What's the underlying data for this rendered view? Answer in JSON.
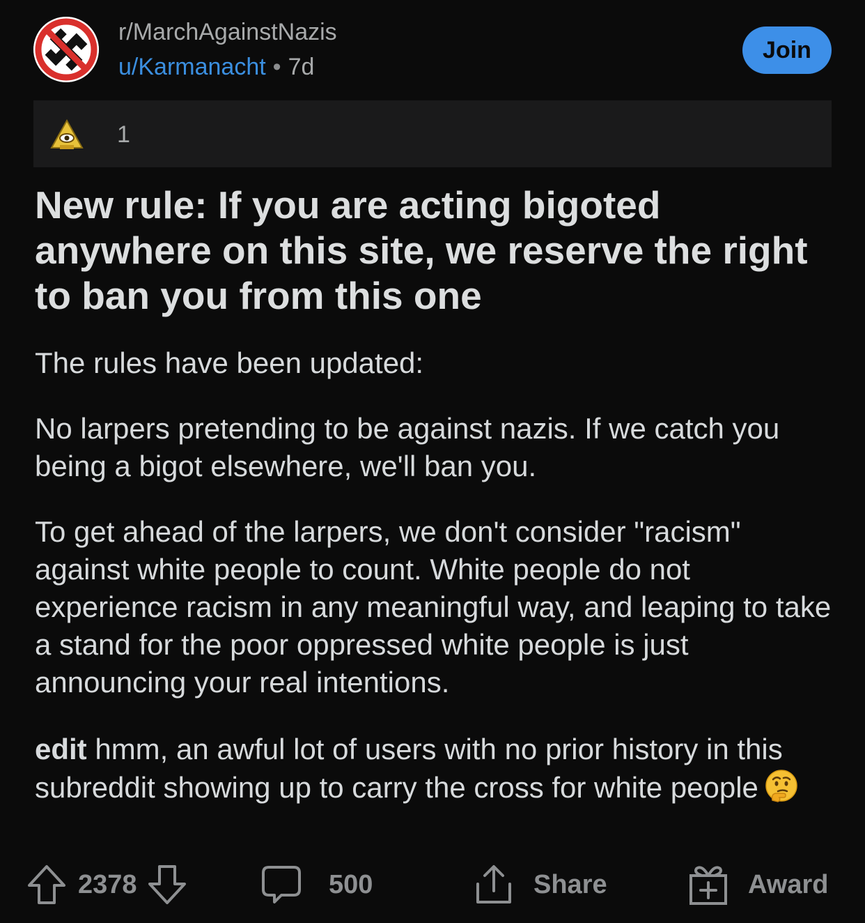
{
  "post": {
    "subreddit": "r/MarchAgainstNazis",
    "author": "u/Karmanacht",
    "separator": "•",
    "age": "7d",
    "join_label": "Join",
    "award_count": "1",
    "title": "New rule: If you are acting bigoted anywhere on this site, we reserve the right to ban you from this one",
    "body": {
      "p1": "The rules have been updated:",
      "p2": "No larpers pretending to be against nazis. If we catch you being a bigot elsewhere, we'll ban you.",
      "p3": "To get ahead of the larpers, we don't consider \"racism\" against white people to count.  White people do not experience racism in any meaningful way, and leaping to take a stand for the poor oppressed white people is just announcing your real intentions.",
      "edit_label": "edit",
      "p4": " hmm, an awful lot of users with no prior history in this subreddit showing up to carry the cross for white people"
    }
  },
  "actions": {
    "vote_count": "2378",
    "comment_count": "500",
    "share_label": "Share",
    "award_label": "Award"
  },
  "icons": {
    "avatar": "no-swastika-avatar-icon",
    "award": "illuminati-award-icon",
    "emoji": "thinking-face-emoji",
    "upvote": "upvote-arrow-icon",
    "downvote": "downvote-arrow-icon",
    "comment": "comment-bubble-icon",
    "share": "share-icon",
    "award_button": "gift-box-icon"
  },
  "colors": {
    "background": "#0b0b0b",
    "accent": "#3d8fe8",
    "username": "#3b8fe0",
    "muted": "#8e9092",
    "award_box": "#1a1a1b"
  }
}
